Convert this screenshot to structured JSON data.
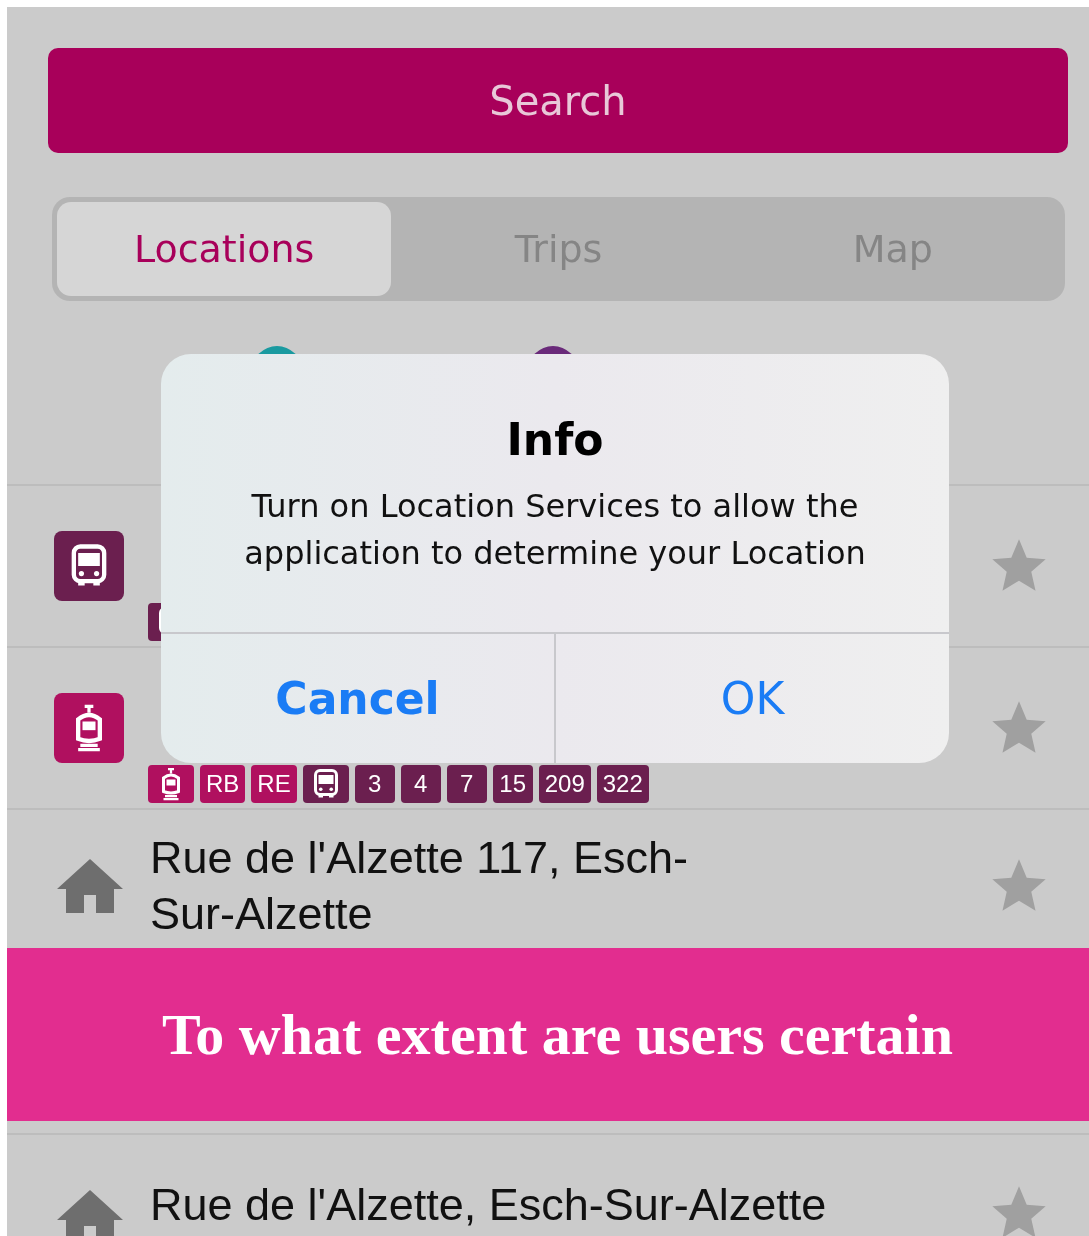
{
  "search_button": {
    "label": "Search"
  },
  "tabs": [
    {
      "label": "Locations",
      "selected": true
    },
    {
      "label": "Trips",
      "selected": false
    },
    {
      "label": "Map",
      "selected": false
    }
  ],
  "shortcuts": [
    {
      "color": "#1a9aa0"
    },
    {
      "color": "#6a2a7a"
    }
  ],
  "results": [
    {
      "kind": "bus",
      "badges": [
        {
          "kind": "bus",
          "color": "#6b1f4f"
        }
      ]
    },
    {
      "kind": "tram",
      "badges": [
        {
          "kind": "tram",
          "color": "#b0105f"
        },
        {
          "kind": "line",
          "label": "RB",
          "color": "#b0105f"
        },
        {
          "kind": "line",
          "label": "RE",
          "color": "#b0105f"
        },
        {
          "kind": "bus",
          "color": "#6b1f4f"
        },
        {
          "kind": "line",
          "label": "3",
          "color": "#6b1f4f"
        },
        {
          "kind": "line",
          "label": "4",
          "color": "#6b1f4f"
        },
        {
          "kind": "line",
          "label": "7",
          "color": "#6b1f4f"
        },
        {
          "kind": "line",
          "label": "15",
          "color": "#6b1f4f"
        },
        {
          "kind": "line",
          "label": "209",
          "color": "#6b1f4f"
        },
        {
          "kind": "line",
          "label": "322",
          "color": "#6b1f4f"
        }
      ]
    },
    {
      "kind": "address",
      "title": "Rue de l'Alzette 117, Esch-Sur-Alzette"
    },
    {
      "kind": "banner",
      "text": "To what extent are users certain"
    },
    {
      "kind": "address",
      "title": "Rue de l'Alzette, Esch-Sur-Alzette"
    }
  ],
  "dialog": {
    "title": "Info",
    "message": "Turn on Location Services to allow the application to determine your Location",
    "buttons": [
      {
        "label": "Cancel",
        "kind": "cancel"
      },
      {
        "label": "OK",
        "kind": "default"
      }
    ]
  }
}
